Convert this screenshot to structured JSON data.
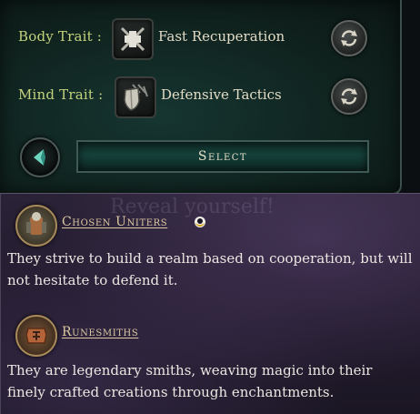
{
  "traits": {
    "body": {
      "label": "Body Trait :",
      "name": "Fast Recuperation",
      "icon": "crossed-swords-plus-icon"
    },
    "mind": {
      "label": "Mind Trait :",
      "name": "Defensive Tactics",
      "icon": "shield-arrows-icon"
    }
  },
  "actions": {
    "select_label": "Select",
    "back_icon": "back-arrow-icon",
    "reroll_icon": "reroll-icon"
  },
  "background_text": "Reveal yourself!",
  "factions": [
    {
      "name": "Chosen Uniters",
      "description": "They strive to build a realm based on cooperation, but will not hesitate to defend it.",
      "emblem": "uniters-emblem-icon",
      "marker": "crescent-ring-icon"
    },
    {
      "name": "Runesmiths",
      "description": "They are legendary smiths, weaving magic into their finely crafted creations through enchantments.",
      "emblem": "runesmiths-emblem-icon"
    }
  ],
  "colors": {
    "trait_label": "#c3d27c",
    "trait_name": "#e2dcc6",
    "faction_name": "#dcc8a2",
    "panel_teal": "#10231f",
    "panel_purple": "#231b2e"
  }
}
